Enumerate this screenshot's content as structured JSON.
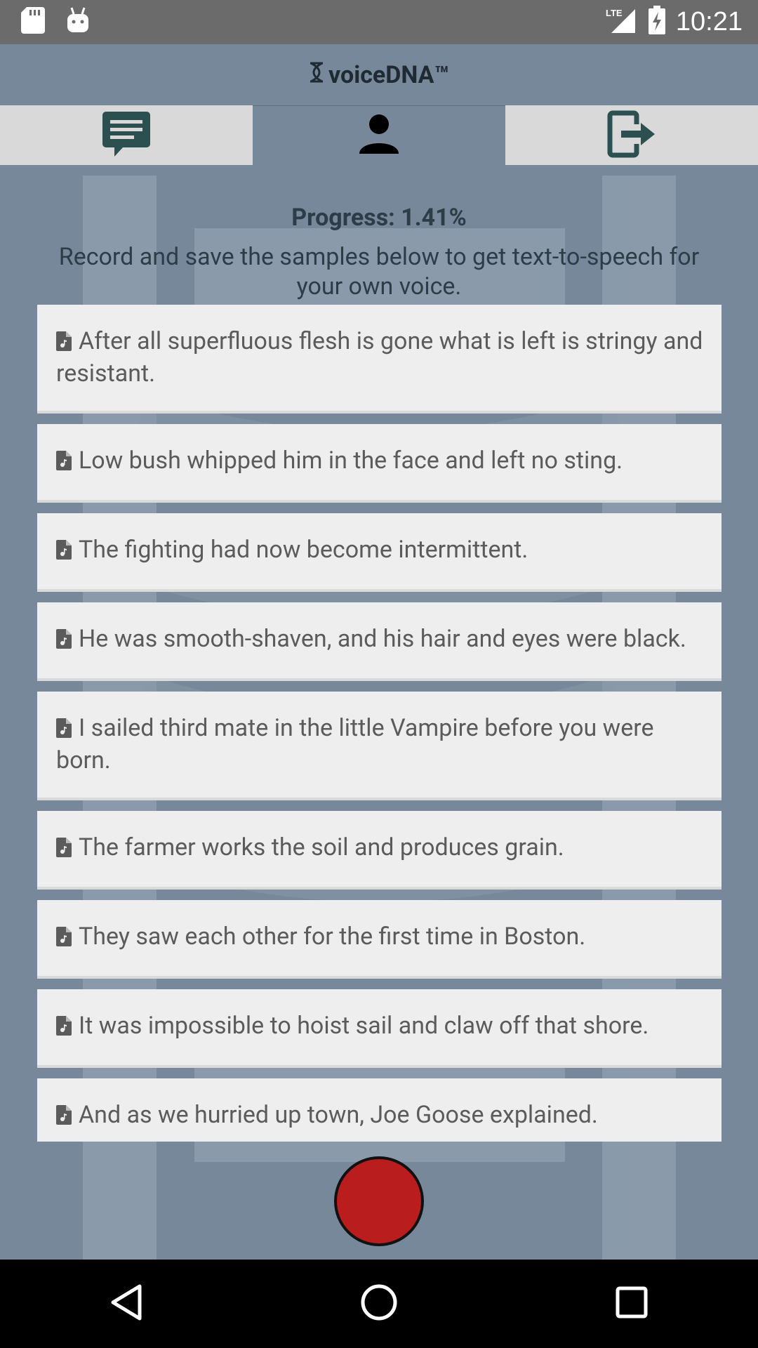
{
  "status_bar": {
    "time": "10:21",
    "network": "LTE",
    "icons": [
      "sd-card-icon",
      "android-icon",
      "signal-icon",
      "battery-charging-icon"
    ]
  },
  "app_bar": {
    "title": "voiceDNA™",
    "logo_icon": "dna-icon"
  },
  "tabs": [
    {
      "icon": "chat-icon",
      "active": false
    },
    {
      "icon": "person-icon",
      "active": true
    },
    {
      "icon": "logout-icon",
      "active": false
    }
  ],
  "progress": {
    "label": "Progress: 1.41%",
    "value_percent": 1.41
  },
  "instructions": "Record and save the samples below to get text-to-speech for your own voice.",
  "samples": [
    "After all superfluous flesh is gone what is left is stringy and resistant.",
    "Low bush whipped him in the face and left no sting.",
    "The fighting had now become intermittent.",
    "He was smooth-shaven, and his hair and eyes were black.",
    "I sailed third mate in the little Vampire before you were born.",
    "The farmer works the soil and produces grain.",
    "They saw each other for the first time in Boston.",
    "It was impossible to hoist sail and claw off that shore.",
    "And as we hurried up town, Joe Goose explained."
  ],
  "record_button": {
    "icon": "record-icon"
  },
  "nav_bar": {
    "icons": [
      "back-icon",
      "home-icon",
      "recents-icon"
    ]
  },
  "colors": {
    "background": "#76889a",
    "record": "#b91d1d",
    "card": "#eeeeee",
    "tab_inactive": "#d9d9d9",
    "icon_teal": "#2c4f4f"
  }
}
